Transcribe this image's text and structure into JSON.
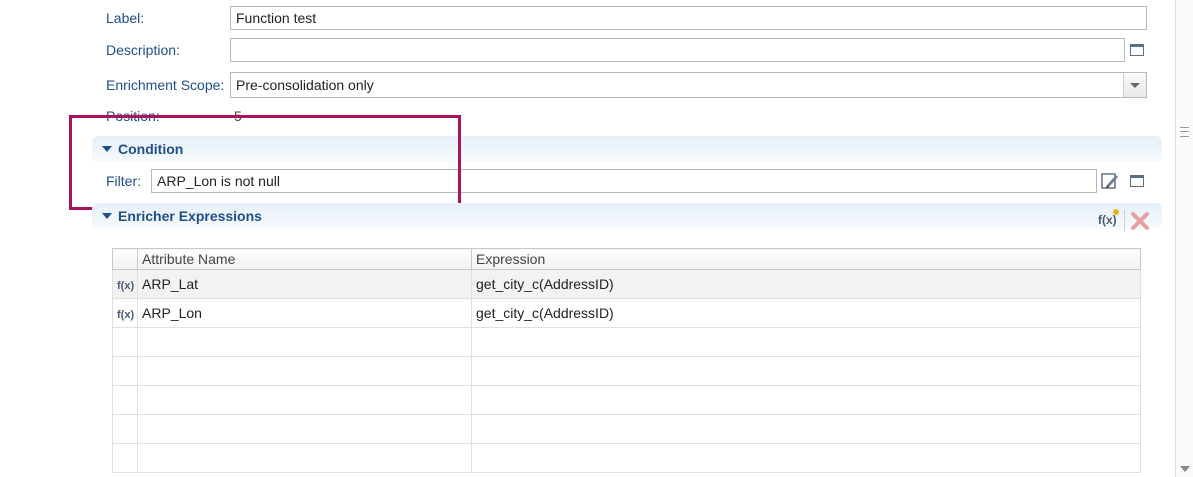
{
  "general": {
    "label_caption": "Label:",
    "label_value": "Function test",
    "description_caption": "Description:",
    "description_value": "",
    "scope_caption": "Enrichment Scope:",
    "scope_value": "Pre-consolidation only",
    "position_caption": "Position:",
    "position_value": "5"
  },
  "condition": {
    "title": "Condition",
    "filter_caption": "Filter:",
    "filter_value": "ARP_Lon is not null"
  },
  "enricher": {
    "title": "Enricher Expressions",
    "fx_button_label": "f(x)",
    "columns": [
      "Attribute Name",
      "Expression"
    ],
    "rows": [
      {
        "icon": "f(x)",
        "attribute": "ARP_Lat",
        "expression": "get_city_c(AddressID)"
      },
      {
        "icon": "f(x)",
        "attribute": "ARP_Lon",
        "expression": "get_city_c(AddressID)"
      }
    ]
  },
  "colors": {
    "label_blue": "#1f4e8c",
    "highlight": "#a8125f",
    "delete_icon": "#e8a0a0"
  }
}
